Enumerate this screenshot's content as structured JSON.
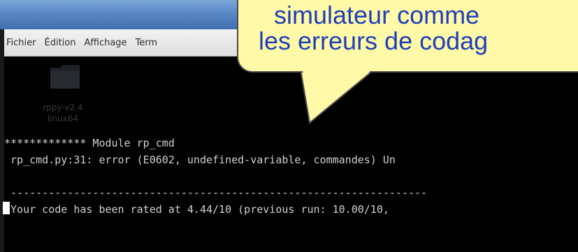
{
  "menubar": {
    "items": [
      "Fichier",
      "Édition",
      "Affichage",
      "Term"
    ]
  },
  "desktop_icon": {
    "name_line1": "rppy-v2.4",
    "name_line2": "linux64",
    "icon": "folder-icon"
  },
  "terminal": {
    "lines": [
      "************* Module rp_cmd",
      " rp_cmd.py:31: error (E0602, undefined-variable, commandes) Un",
      " ------------------------------------------------------------------",
      " Your code has been rated at 4.44/10 (previous run: 10.00/10,"
    ]
  },
  "callout": {
    "line1": "simulateur comme",
    "line2": "les erreurs de codag"
  },
  "colors": {
    "title_bar": "#5a88c4",
    "menubar_bg": "#e8e8e8",
    "terminal_bg": "#000000",
    "terminal_text": "#d0d0d0",
    "bubble_fill": "#fff9a8",
    "bubble_text": "#1f3fb8"
  }
}
